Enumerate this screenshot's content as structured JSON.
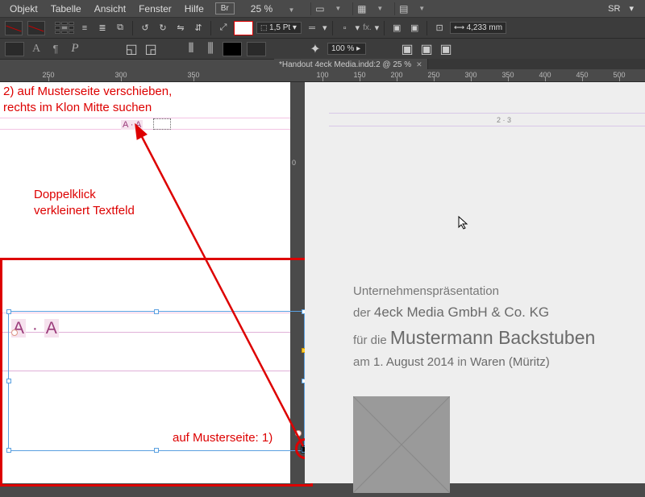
{
  "menu": {
    "objekt": "Objekt",
    "tabelle": "Tabelle",
    "ansicht": "Ansicht",
    "fenster": "Fenster",
    "hilfe": "Hilfe",
    "br": "Br",
    "zoom": "25 %",
    "sr": "SR"
  },
  "tb": {
    "stroke": "1,5 Pt",
    "opacity": "100 %",
    "w": "4,233 mm"
  },
  "tab": {
    "label": "*Handout 4eck Media.indd:2 @ 25 %"
  },
  "ruler_h1": [
    "250",
    "300",
    "350"
  ],
  "ruler_h2": [
    "100",
    "150",
    "200",
    "250",
    "300",
    "350",
    "400",
    "450",
    "500"
  ],
  "ruler_v": [
    "0"
  ],
  "page_num": "2 · 3",
  "anno": {
    "top1": "2) auf Musterseite verschieben,",
    "top2": "rechts im Klon Mitte suchen",
    "mid1": "Doppelklick",
    "mid2": "verkleinert Textfeld",
    "bot": "auf Musterseite: 1)"
  },
  "marker": {
    "small": "A · A",
    "large_a": "A",
    "large_dot": "·",
    "large_b": "A"
  },
  "pres": {
    "l1": "Unternehmenspräsentation",
    "l2a": "der",
    "l2b": "4eck Media GmbH & Co. KG",
    "l3a": "für die",
    "l3b": "Mustermann Backstuben",
    "l4a": "am",
    "l4b": "1. August 2014",
    "l4c": "in",
    "l4d": "Waren (Müritz)"
  }
}
